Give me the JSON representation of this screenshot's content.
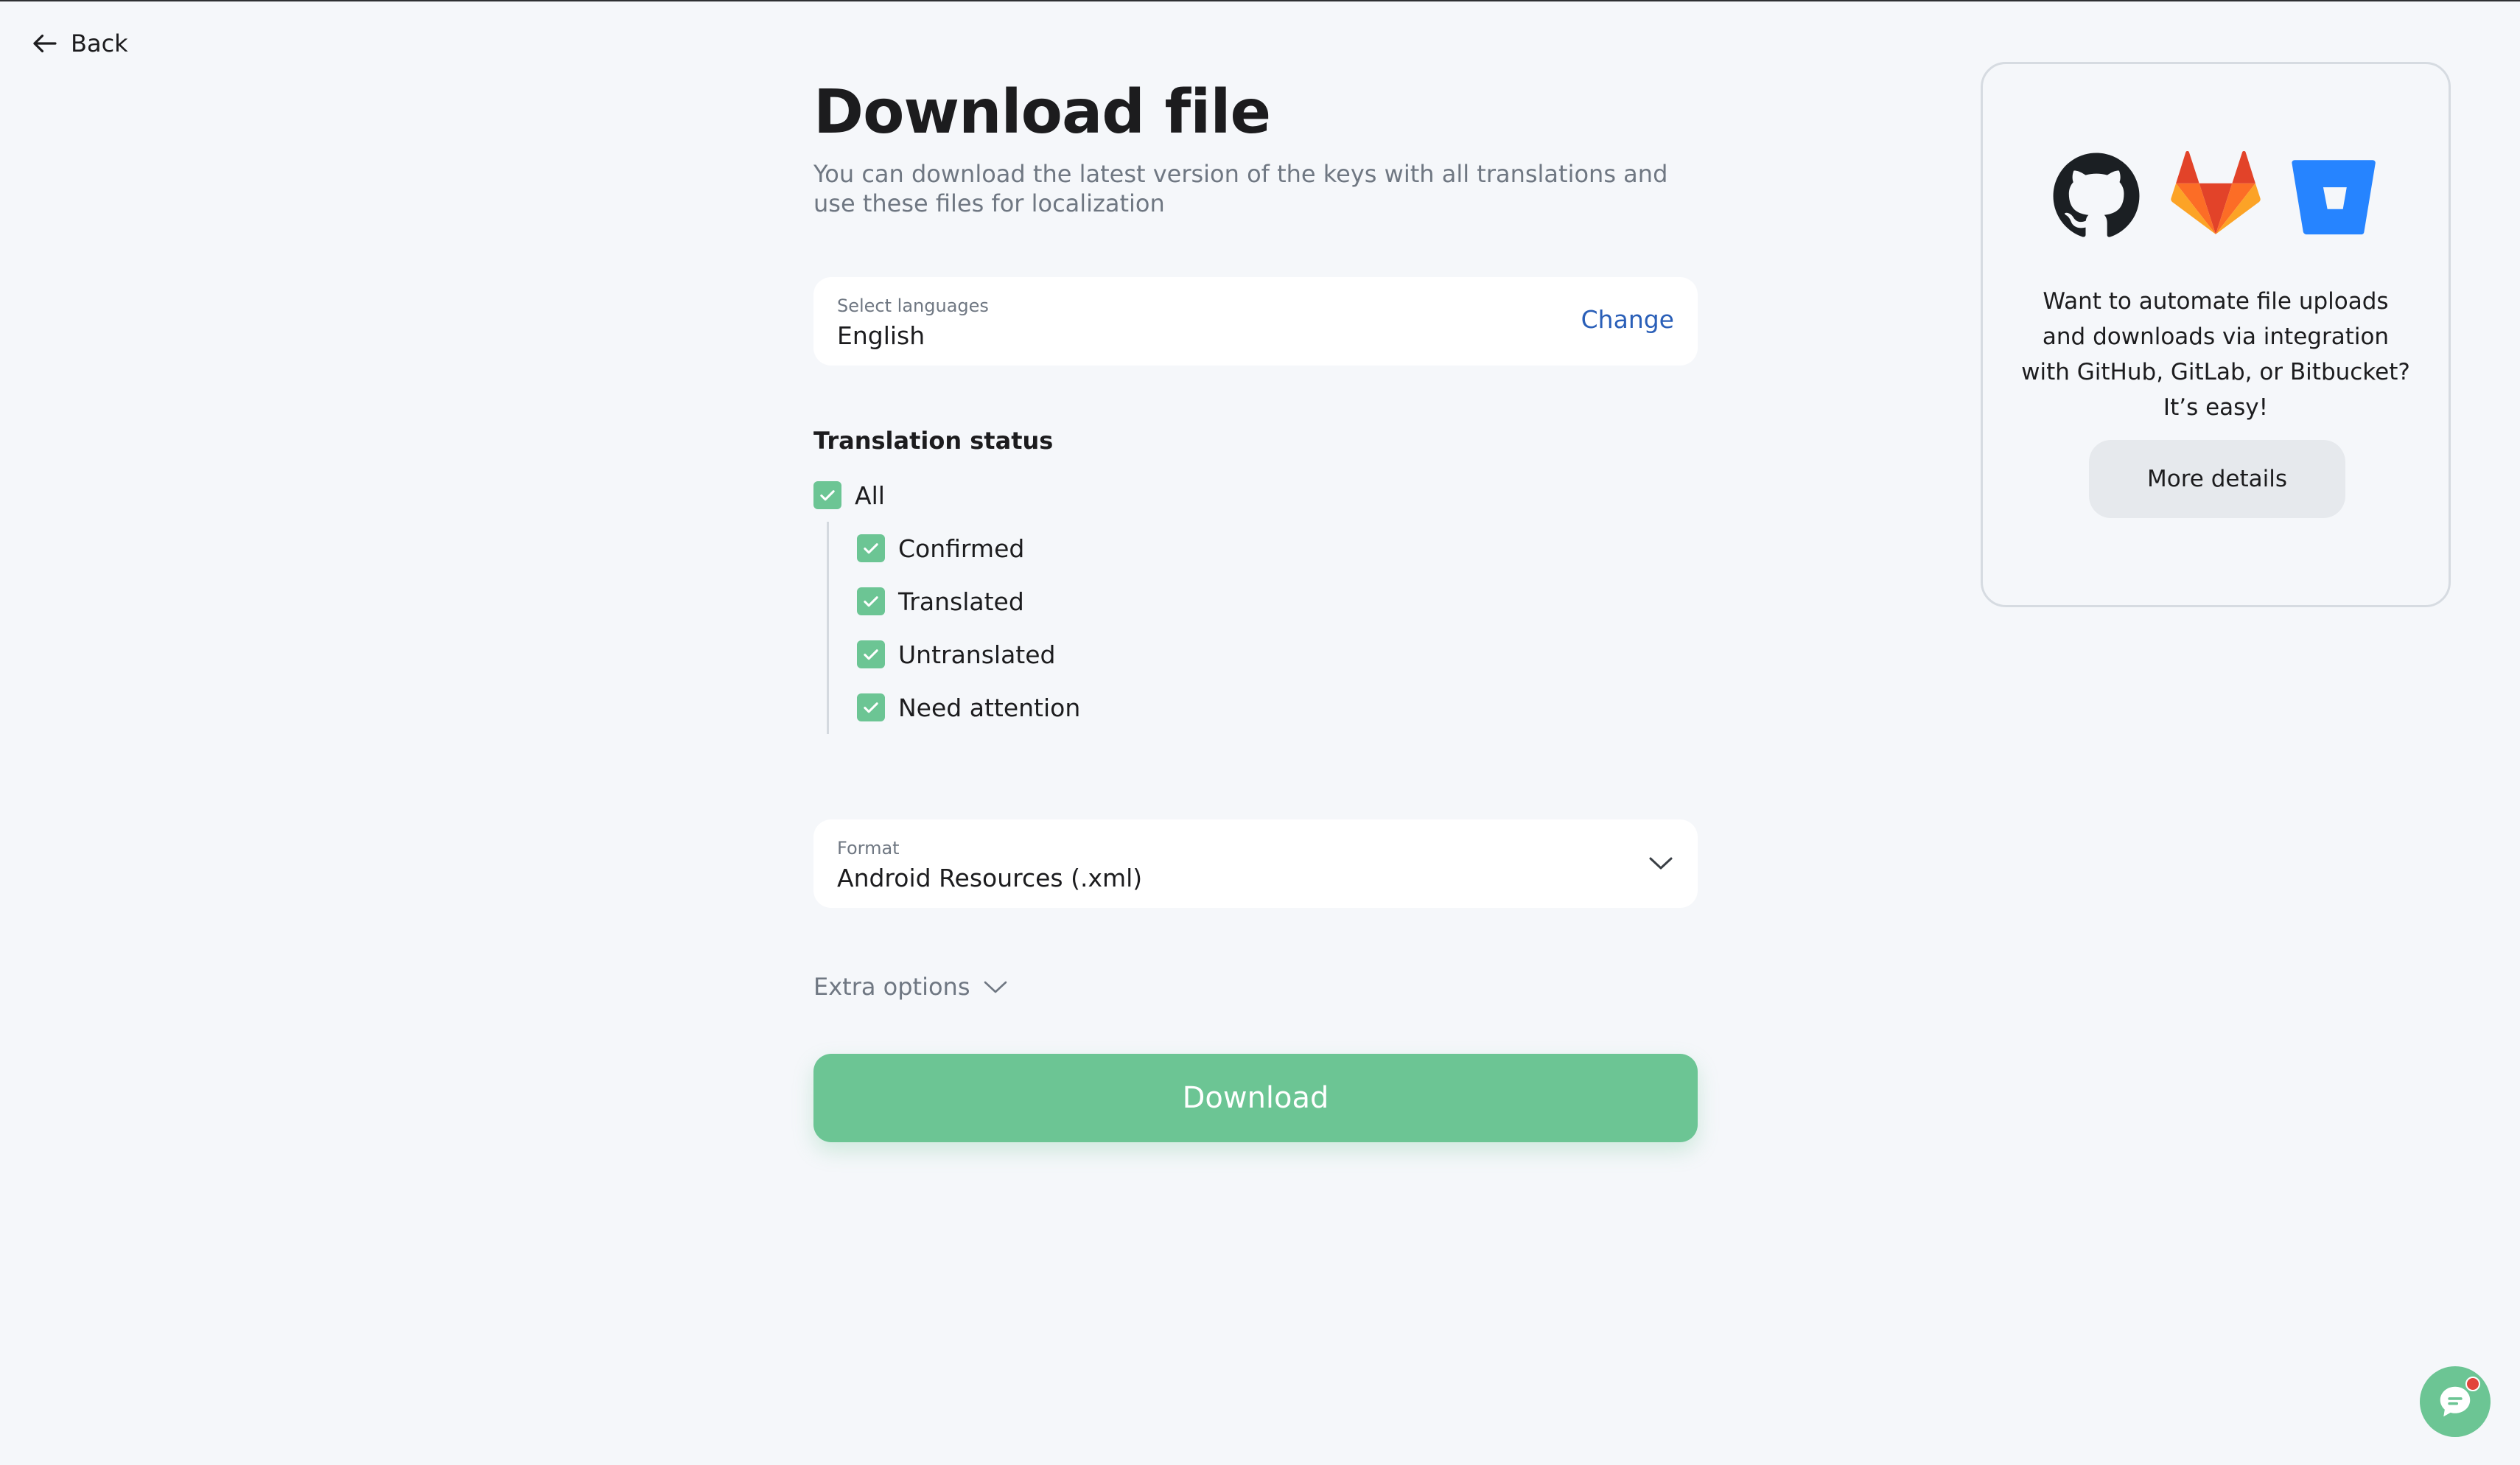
{
  "nav": {
    "back_label": "Back"
  },
  "page": {
    "title": "Download file",
    "subtitle": "You can download the latest version of the keys with all translations and use these files for localization"
  },
  "languages": {
    "label": "Select languages",
    "value": "English",
    "change_label": "Change"
  },
  "translation_status": {
    "heading": "Translation status",
    "all": {
      "label": "All",
      "checked": true
    },
    "options": [
      {
        "label": "Confirmed",
        "checked": true
      },
      {
        "label": "Translated",
        "checked": true
      },
      {
        "label": "Untranslated",
        "checked": true
      },
      {
        "label": "Need attention",
        "checked": true
      }
    ]
  },
  "format": {
    "label": "Format",
    "value": "Android Resources (.xml)"
  },
  "extra_options": {
    "label": "Extra options"
  },
  "download": {
    "label": "Download"
  },
  "integration_card": {
    "logos": [
      "github-icon",
      "gitlab-icon",
      "bitbucket-icon"
    ],
    "text": "Want to automate file uploads and downloads via integration with GitHub, GitLab, or Bitbucket? It’s easy!",
    "button_label": "More details"
  },
  "chat": {
    "icon": "chat-icon",
    "has_notification": true
  },
  "colors": {
    "accent_green": "#6cc594",
    "link_blue": "#2a5fb8",
    "background": "#f5f7fa",
    "muted_text": "#6f7782",
    "notification_red": "#e2453c"
  }
}
